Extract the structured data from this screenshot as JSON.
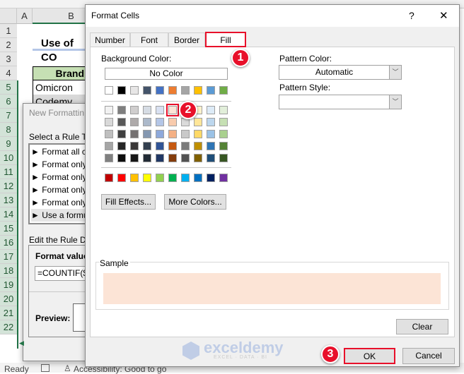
{
  "excel": {
    "columns": [
      "A",
      "B"
    ],
    "rows": [
      "1",
      "2",
      "3",
      "4",
      "5",
      "6",
      "7",
      "8",
      "9",
      "10",
      "11",
      "12",
      "13",
      "14",
      "15",
      "16",
      "17",
      "18",
      "19",
      "20",
      "21",
      "22"
    ],
    "title_cell": "Use of CO",
    "header_cell": "Brand",
    "cells": [
      "Omicron",
      "Codemy"
    ],
    "status": {
      "ready": "Ready",
      "accessibility": "Accessibility: Good to go"
    }
  },
  "new_rule_dialog": {
    "title": "New Formattin",
    "select_label": "Select a Rule Ty",
    "rule_types": [
      "► Format all c",
      "► Format only",
      "► Format only",
      "► Format only",
      "► Format only",
      "► Use a formu"
    ],
    "edit_label": "Edit the Rule De",
    "format_values_label": "Format values",
    "formula": "=COUNTIF($E",
    "preview_label": "Preview:"
  },
  "format_cells": {
    "title": "Format Cells",
    "help": "?",
    "close": "✕",
    "tabs": [
      "Number",
      "Font",
      "Border",
      "Fill"
    ],
    "active_tab": "Fill",
    "background_color_label": "Background Color:",
    "no_color": "No Color",
    "theme_colors": [
      "#FFFFFF",
      "#000000",
      "#E7E6E6",
      "#44546A",
      "#4472C4",
      "#ED7D31",
      "#A5A5A5",
      "#FFC000",
      "#5B9BD5",
      "#70AD47"
    ],
    "tints": [
      [
        "#F2F2F2",
        "#7F7F7F",
        "#D0CECE",
        "#D6DCE4",
        "#D9E1F2",
        "#FCE4D6",
        "#EDEDED",
        "#FFF2CC",
        "#DDEBF7",
        "#E2EFDA"
      ],
      [
        "#D9D9D9",
        "#595959",
        "#AEAAAA",
        "#ACB9CA",
        "#B4C6E7",
        "#F8CBAD",
        "#DBDBDB",
        "#FFE699",
        "#BDD7EE",
        "#C6E0B4"
      ],
      [
        "#BFBFBF",
        "#404040",
        "#757171",
        "#8497B0",
        "#8EA9DB",
        "#F4B084",
        "#C9C9C9",
        "#FFD966",
        "#9BC2E6",
        "#A9D08E"
      ],
      [
        "#A6A6A6",
        "#262626",
        "#3A3838",
        "#333F4F",
        "#305496",
        "#C65911",
        "#7B7B7B",
        "#BF8F00",
        "#2F75B5",
        "#548235"
      ],
      [
        "#808080",
        "#0D0D0D",
        "#161616",
        "#222B35",
        "#203764",
        "#833C0C",
        "#525252",
        "#806000",
        "#1F4E78",
        "#375623"
      ]
    ],
    "standard_colors": [
      "#C00000",
      "#FF0000",
      "#FFC000",
      "#FFFF00",
      "#92D050",
      "#00B050",
      "#00B0F0",
      "#0070C0",
      "#002060",
      "#7030A0"
    ],
    "selected_color": "#FCE4D6",
    "fill_effects": "Fill Effects...",
    "more_colors": "More Colors...",
    "pattern_color_label": "Pattern Color:",
    "pattern_color_value": "Automatic",
    "pattern_style_label": "Pattern Style:",
    "pattern_style_value": "",
    "sample_label": "Sample",
    "clear": "Clear",
    "ok": "OK",
    "cancel": "Cancel"
  },
  "annotations": [
    "1",
    "2",
    "3"
  ],
  "watermark": {
    "brand": "exceldemy",
    "tagline": "EXCEL · DATA · BI"
  },
  "colors": {
    "highlight": "#E8102A",
    "excel_green": "#217346"
  }
}
